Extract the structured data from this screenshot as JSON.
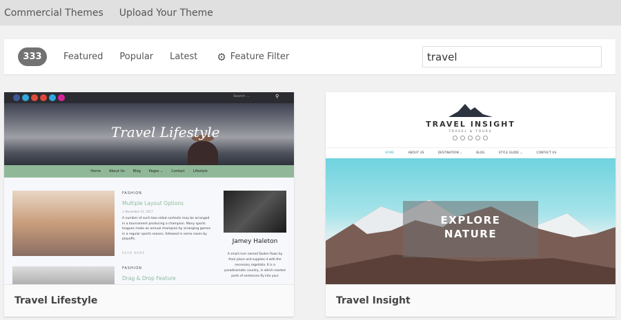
{
  "topnav": {
    "items": [
      "Commercial Themes",
      "Upload Your Theme"
    ]
  },
  "filter": {
    "count": "333",
    "tabs": [
      "Featured",
      "Popular",
      "Latest"
    ],
    "feature_filter": "Feature Filter",
    "search_value": "travel"
  },
  "themes": [
    {
      "name": "Travel Lifestyle",
      "preview": {
        "search": "Search ...",
        "logo": "Travel Lifestyle",
        "nav": [
          "Home",
          "About Us",
          "Blog",
          "Pages ⌄",
          "Contact",
          "Lifestyle"
        ],
        "posts": [
          {
            "category": "FASHION",
            "title": "Multiple Layout Options",
            "date": "⊙ November 21, 2017",
            "excerpt": "A number of such two-sided contests may be arranged in a tournament producing a champion. Many sports leagues make an annual champion by arranging games in a regular sports season, followed in some cases by playoffs.",
            "read_more": "READ MORE"
          },
          {
            "category": "FASHION",
            "title": "Drag & Drop Feature"
          }
        ],
        "profile": {
          "name": "Jamey Haleton",
          "bio": "A small river named Duden flows by their place and supplies it with the necessary regelialia. It is a paradisematic country, in which roasted parts of sentences fly into your"
        }
      }
    },
    {
      "name": "Travel Insight",
      "preview": {
        "logo": "TRAVEL INSIGHT",
        "tagline": "TRAVEL & TOURS",
        "nav": [
          "HOME",
          "ABOUT US",
          "DESTINATION ⌄",
          "BLOG",
          "STYLE GUIDE ⌄",
          "CONTACT US"
        ],
        "hero_line1": "EXPLORE",
        "hero_line2": "NATURE"
      }
    }
  ]
}
